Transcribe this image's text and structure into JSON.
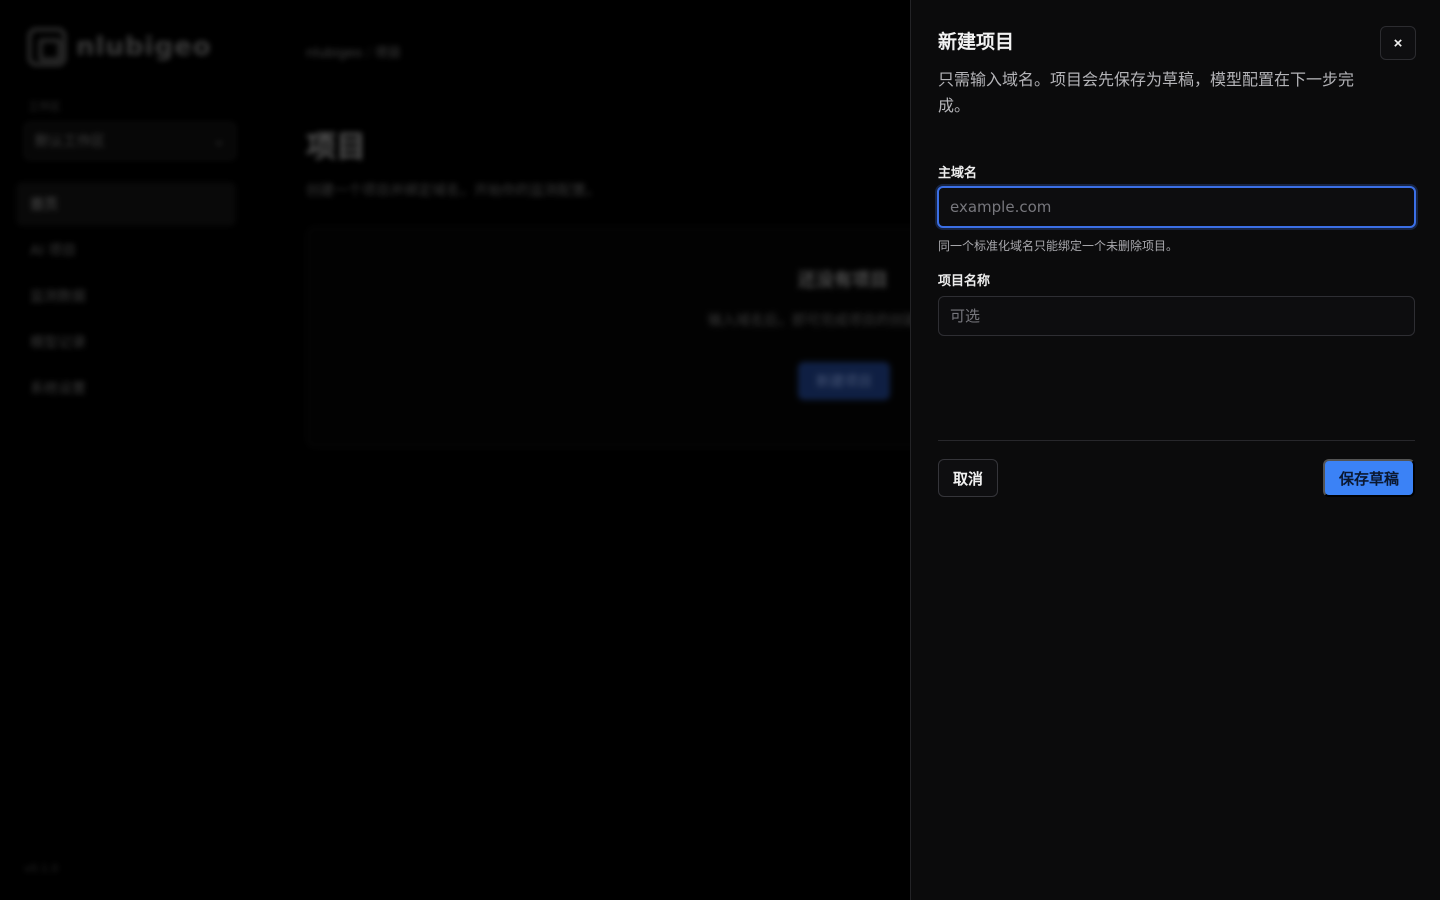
{
  "background": {
    "logo_text": "nlubigeo",
    "workspace_label": "工作区",
    "workspace_value": "默认工作区",
    "nav_items": [
      "首页",
      "AI 项目",
      "监测数据",
      "模型记录",
      "系统设置"
    ],
    "footer": "v0.1.0",
    "breadcrumb": {
      "root": "nlubigeo",
      "current": "项目"
    },
    "page_title": "项目",
    "page_subtitle": "创建一个项目并绑定域名，开始你的监测配置。",
    "empty_title": "还没有项目",
    "empty_text": "输入域名后，即可完成项目的创建流程",
    "empty_button": "新建项目"
  },
  "drawer": {
    "title": "新建项目",
    "close_label": "×",
    "description": "只需输入域名。项目会先保存为草稿，模型配置在下一步完成。",
    "domain_field": {
      "label": "主域名",
      "placeholder": "example.com",
      "value": "",
      "hint": "同一个标准化域名只能绑定一个未删除项目。"
    },
    "name_field": {
      "label": "项目名称",
      "placeholder": "可选",
      "value": ""
    },
    "cancel_label": "取消",
    "save_label": "保存草稿"
  },
  "colors": {
    "accent": "#3b82f6",
    "focus_ring": "#3b6fe6",
    "drawer_bg": "#0b0b0c",
    "page_bg": "#000000"
  }
}
